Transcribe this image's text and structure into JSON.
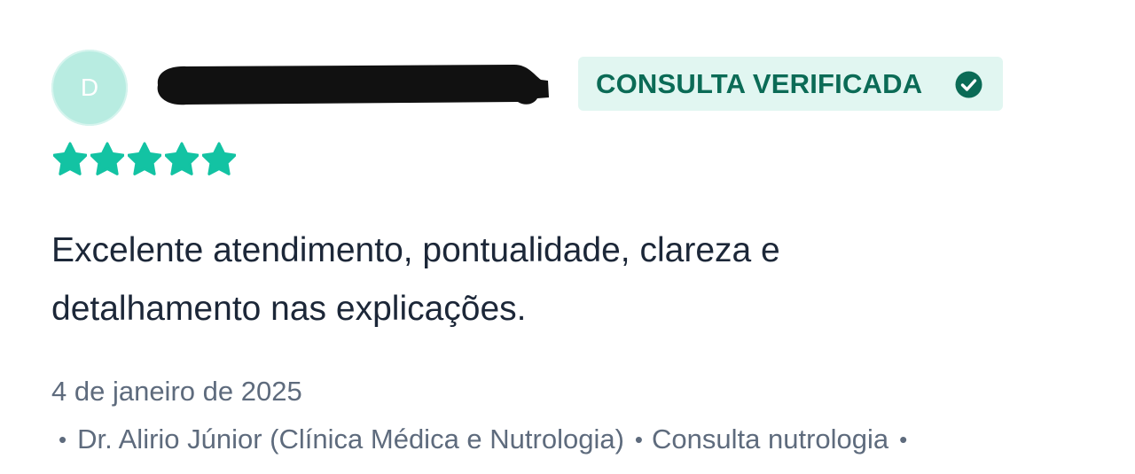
{
  "review": {
    "avatar_letter": "D",
    "badge_label": "CONSULTA VERIFICADA",
    "badge_icon": "check-circle-icon",
    "rating": 5,
    "rating_max": 5,
    "text": "Excelente atendimento, pontualidade, clareza e detalhamento nas explicações.",
    "date": "4 de janeiro de 2025",
    "doctor": "Dr. Alirio Júnior (Clínica Médica e Nutrologia)",
    "service": "Consulta nutrologia",
    "bullet": "•"
  },
  "colors": {
    "accent": "#13c3a3",
    "badge_bg": "#e1f6f1",
    "badge_text": "#0b6b56",
    "avatar_bg": "#b8ece1",
    "body_text": "#1c2738",
    "muted_text": "#5e6b7d",
    "redaction": "#111111"
  }
}
